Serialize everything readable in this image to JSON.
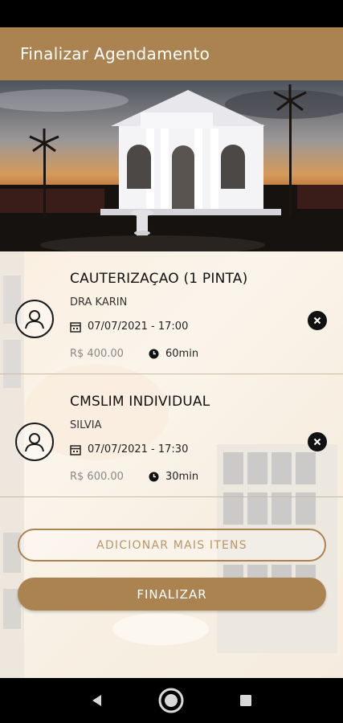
{
  "app_bar": {
    "title": "Finalizar Agendamento"
  },
  "items": [
    {
      "service": "CAUTERIZAÇAO (1 PINTA)",
      "professional": "DRA KARIN",
      "datetime": "07/07/2021 - 17:00",
      "price": "R$ 400.00",
      "duration": "60min"
    },
    {
      "service": "CMSLIM INDIVIDUAL",
      "professional": "SILVIA",
      "datetime": "07/07/2021 - 17:30",
      "price": "R$ 600.00",
      "duration": "30min"
    }
  ],
  "buttons": {
    "add_more": "ADICIONAR MAIS ITENS",
    "finish": "FINALIZAR"
  },
  "icons": {
    "avatar": "user-outline-icon",
    "calendar": "calendar-icon",
    "clock": "clock-icon",
    "remove": "close-circle-icon",
    "back": "nav-back-icon",
    "home": "nav-home-icon",
    "recents": "nav-recents-icon"
  },
  "colors": {
    "accent": "#ab8350",
    "remove_bg": "#111111"
  }
}
